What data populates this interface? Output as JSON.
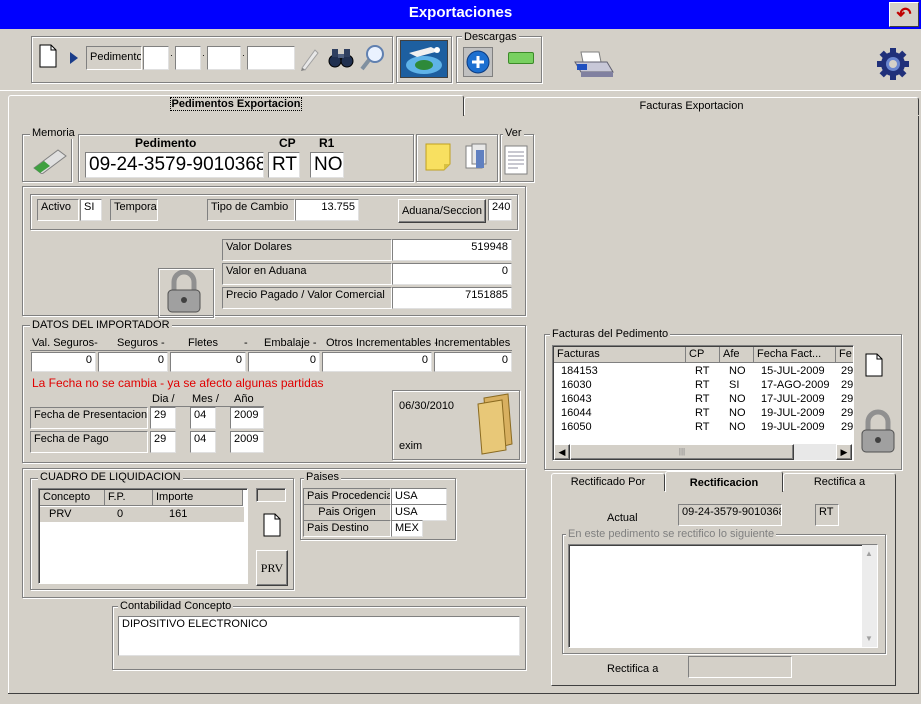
{
  "window": {
    "title": "Exportaciones"
  },
  "toolbar": {
    "pedimento_label": "Pedimento",
    "descargas_label": "Descargas"
  },
  "tabs": {
    "pedimentos": "Pedimentos Exportacion",
    "facturas": "Facturas Exportacion"
  },
  "memoria": {
    "label": "Memoria"
  },
  "pedimento": {
    "header_pedimento": "Pedimento",
    "header_cp": "CP",
    "header_r1": "R1",
    "numero": "09-24-3579-9010368",
    "cp": "RT",
    "r1": "NO",
    "ver_label": "Ver"
  },
  "status": {
    "activo_label": "Activo",
    "activo_value": "SI",
    "temporal_label": "Temporal",
    "tipo_cambio_label": "Tipo de Cambio",
    "tipo_cambio_value": "13.755",
    "aduana_button": "Aduana/Seccion",
    "aduana_value": "240"
  },
  "valores": {
    "dolares_label": "Valor Dolares",
    "dolares_value": "519948",
    "aduana_label": "Valor en Aduana",
    "aduana_value": "0",
    "precio_label": "Precio Pagado  / Valor Comercial",
    "precio_value": "7151885"
  },
  "importador": {
    "title": "DATOS DEL IMPORTADOR",
    "headers": [
      "Val. Seguros-",
      "Seguros  -",
      "Fletes",
      "-",
      "Embalaje  -",
      "Otros Incrementables -",
      "Incrementables"
    ],
    "values": [
      "0",
      "0",
      "0",
      "0",
      "0",
      "0"
    ],
    "warning": "La Fecha no se cambia - ya se afecto algunas partidas",
    "dia_label": "Dia  /",
    "mes_label": "Mes  /",
    "anio_label": "Año",
    "presentacion_label": "Fecha de Presentacion",
    "presentacion": {
      "dia": "29",
      "mes": "04",
      "anio": "2009"
    },
    "pago_label": "Fecha de Pago",
    "pago": {
      "dia": "29",
      "mes": "04",
      "anio": "2009"
    },
    "fecha_info": "06/30/2010",
    "usuario": "exim"
  },
  "liquidacion": {
    "title": "CUADRO DE LIQUIDACION",
    "columns": [
      "Concepto",
      "F.P.",
      "Importe"
    ],
    "rows": [
      {
        "concepto": "PRV",
        "fp": "0",
        "importe": "161"
      }
    ],
    "prv_button": "PRV"
  },
  "paises": {
    "title": "Paises",
    "procedencia_label": "Pais Procedencia",
    "procedencia": "USA",
    "origen_label": "Pais Origen",
    "origen": "USA",
    "destino_label": "Pais Destino",
    "destino": "MEX"
  },
  "contabilidad": {
    "title": "Contabilidad Concepto",
    "value": "DIPOSITIVO ELECTRONICO"
  },
  "facturas": {
    "title": "Facturas del Pedimento",
    "columns": [
      "Facturas",
      "CP",
      "Afe",
      "Fecha Fact...",
      "Fe"
    ],
    "rows": [
      {
        "factura": "184153",
        "cp": "RT",
        "afe": "NO",
        "fecha": "15-JUL-2009",
        "fe": "29"
      },
      {
        "factura": "16030",
        "cp": "RT",
        "afe": "SI",
        "fecha": "17-AGO-2009",
        "fe": "29"
      },
      {
        "factura": "16043",
        "cp": "RT",
        "afe": "NO",
        "fecha": "17-JUL-2009",
        "fe": "29"
      },
      {
        "factura": "16044",
        "cp": "RT",
        "afe": "NO",
        "fecha": "19-JUL-2009",
        "fe": "29"
      },
      {
        "factura": "16050",
        "cp": "RT",
        "afe": "NO",
        "fecha": "19-JUL-2009",
        "fe": "29"
      }
    ]
  },
  "rectificacion": {
    "tabs": [
      "Rectificado Por",
      "Rectificacion",
      "Rectifica a"
    ],
    "actual_label": "Actual",
    "actual_value": "09-24-3579-9010368",
    "actual_cp": "RT",
    "group_label": "En este pedimento se rectifico lo siguiente",
    "rectifica_label": "Rectifica a"
  }
}
